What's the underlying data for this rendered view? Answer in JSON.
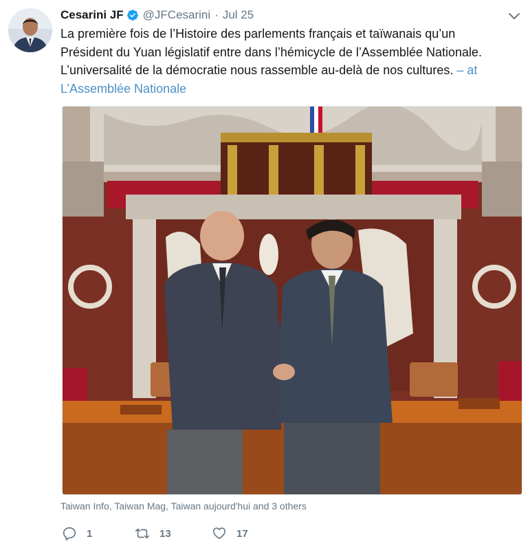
{
  "tweet": {
    "author_name": "Cesarini JF",
    "handle": "@JFCesarini",
    "separator": "·",
    "date": "Jul 25",
    "text_lines": [
      "La première fois de l’Histoire des parlements français et taïwanais qu’un",
      "Président du Yuan législatif entre dans l’hémicycle de l’Assemblée Nationale.",
      "L’universalité de la démocratie nous rassemble au-delà de nos cultures."
    ],
    "location_link_part1": " – at",
    "location_link_part2": "L’Assemblée Nationale",
    "liked_by": "Taiwan Info, Taiwan Mag, Taiwan aujourd'hui and 3 others",
    "reply_count": "1",
    "retweet_count": "13",
    "like_count": "17"
  },
  "colors": {
    "accent": "#1da1f2",
    "link": "#4a90c7",
    "secondary_text": "#657786",
    "primary_text": "#14171a"
  },
  "icons": {
    "verified": "verified-badge-icon",
    "menu": "chevron-down-icon",
    "reply": "reply-icon",
    "retweet": "retweet-icon",
    "like": "heart-icon"
  }
}
